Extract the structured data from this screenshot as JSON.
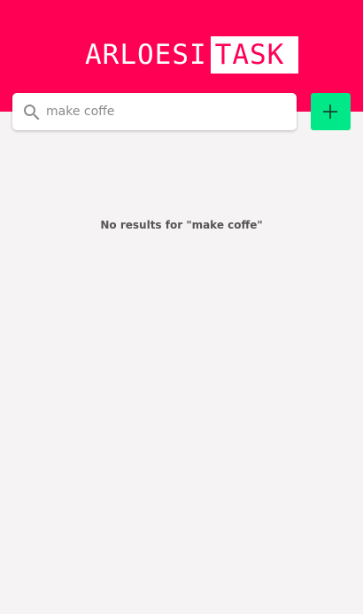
{
  "header": {
    "logo_part1": "ARLOESI",
    "logo_part2": "TASK",
    "background_color": "#ff0055"
  },
  "search": {
    "value": "make coffe",
    "icon": "search-icon"
  },
  "add_button": {
    "icon": "plus-icon",
    "color": "#00e887"
  },
  "results": {
    "empty_message": "No results for \"make coffe\""
  }
}
